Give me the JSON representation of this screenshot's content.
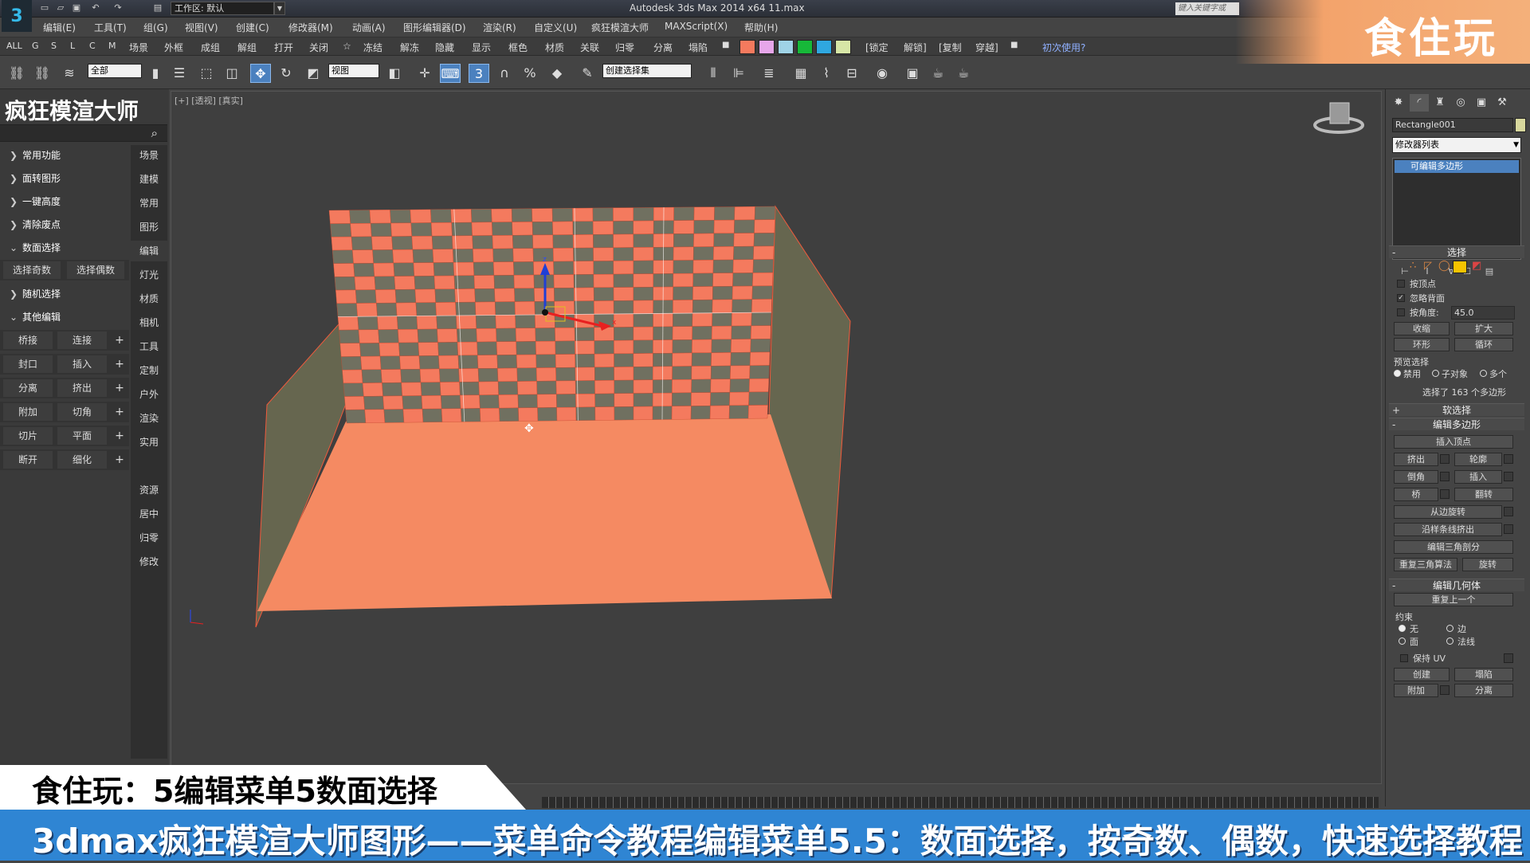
{
  "titlebar": {
    "workspace": "工作区: 默认",
    "title": "Autodesk 3ds Max  2014 x64    11.max",
    "search_placeholder": "键入关键字或"
  },
  "menu": [
    "编辑(E)",
    "工具(T)",
    "组(G)",
    "视图(V)",
    "创建(C)",
    "修改器(M)",
    "动画(A)",
    "图形编辑器(D)",
    "渲染(R)",
    "自定义(U)",
    "疯狂模渲大师",
    "MAXScript(X)",
    "帮助(H)"
  ],
  "quickbar": {
    "letters": [
      "ALL",
      "G",
      "S",
      "L",
      "C",
      "M"
    ],
    "items": [
      "场景",
      "外框",
      "成组",
      "解组",
      "打开",
      "关闭",
      "☆",
      "冻结",
      "解冻",
      "隐藏",
      "显示",
      "框色",
      "材质",
      "关联",
      "归零",
      "分离",
      "塌陷"
    ],
    "colors": [
      "#f47a5e",
      "#e6a6ea",
      "#9fd3e6",
      "#17b839",
      "#2fa7e0",
      "#d7e6a6"
    ],
    "tail": [
      "[锁定",
      "解锁]",
      "[复制",
      "穿越]"
    ],
    "help": "初次使用?"
  },
  "toolbar": {
    "filter_value": "全部",
    "ref_coord_value": "视图",
    "selection_set_value": "创建选择集"
  },
  "leftpanel": {
    "title": "疯狂模渲大师",
    "sections": [
      {
        "label": "常用功能",
        "expanded": false
      },
      {
        "label": "面转图形",
        "expanded": false
      },
      {
        "label": "一键高度",
        "expanded": false
      },
      {
        "label": "清除废点",
        "expanded": false
      },
      {
        "label": "数面选择",
        "expanded": true
      },
      {
        "label": "随机选择",
        "expanded": false
      },
      {
        "label": "其他编辑",
        "expanded": true
      }
    ],
    "face_select_buttons": [
      "选择奇数",
      "选择偶数"
    ],
    "edit_rows": [
      [
        "桥接",
        "连接"
      ],
      [
        "封口",
        "插入"
      ],
      [
        "分离",
        "挤出"
      ],
      [
        "附加",
        "切角"
      ],
      [
        "切片",
        "平面"
      ],
      [
        "断开",
        "细化"
      ]
    ],
    "categories": [
      "场景",
      "建模",
      "常用",
      "图形",
      "编辑",
      "灯光",
      "材质",
      "相机",
      "工具",
      "定制",
      "户外",
      "渲染",
      "实用",
      "资源",
      "居中",
      "归零",
      "修改"
    ],
    "selected_category": "编辑"
  },
  "viewport": {
    "label": "[+] [透视] [真实]"
  },
  "rightpanel": {
    "object_name": "Rectangle001",
    "modifier_list": "修改器列表",
    "stack_item": "可编辑多边形",
    "selection": {
      "title": "选择",
      "by_vertex": "按顶点",
      "ignore_backface": "忽略背面",
      "by_angle": "按角度:",
      "angle_value": "45.0",
      "shrink": "收缩",
      "grow": "扩大",
      "ring": "环形",
      "loop": "循环",
      "preview_label": "预览选择",
      "preview_options": [
        "禁用",
        "子对象",
        "多个"
      ],
      "status": "选择了 163 个多边形"
    },
    "soft_selection": "软选择",
    "edit_poly": {
      "title": "编辑多边形",
      "insert_vertex": "插入顶点",
      "extrude": "挤出",
      "outline": "轮廓",
      "bevel": "倒角",
      "inset": "插入",
      "bridge": "桥",
      "flip": "翻转",
      "hinge": "从边旋转",
      "extrude_spline": "沿样条线挤出",
      "edit_tri": "编辑三角剖分",
      "retri": "重复三角算法",
      "turn": "旋转"
    },
    "edit_geometry": {
      "title": "编辑几何体",
      "repeat_last": "重复上一个",
      "constraints_label": "约束",
      "c_none": "无",
      "c_edge": "边",
      "c_face": "面",
      "c_normal": "法线",
      "preserve_uv": "保持 UV",
      "create": "创建",
      "collapse": "塌陷",
      "attach": "附加",
      "detach": "分离"
    }
  },
  "overlay": {
    "watermark": "食住玩",
    "caption_top": "食住玩：5编辑菜单5数面选择",
    "caption_bottom": "3dmax疯狂模渲大师图形——菜单命令教程编辑菜单5.5：数面选择，按奇数、偶数，快速选择教程"
  },
  "colors": {
    "selected_face": "#f47a5e",
    "unselected_face": "#707060",
    "floor": "#f58a62",
    "side_wall": "#66664f"
  }
}
